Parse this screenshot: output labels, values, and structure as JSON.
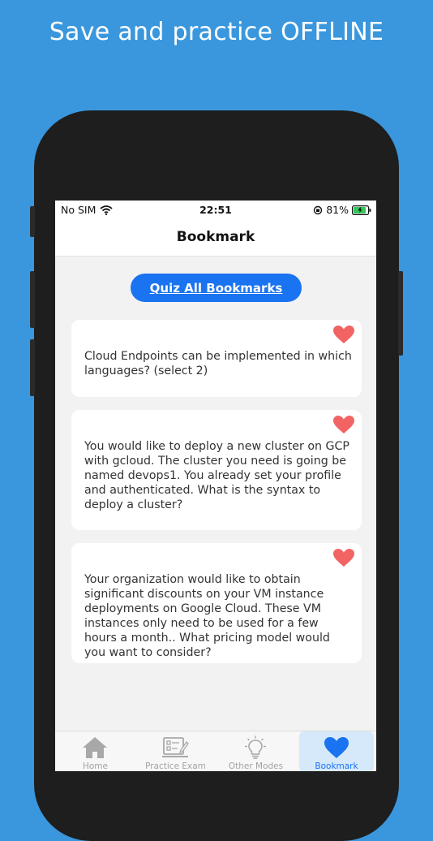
{
  "promo": {
    "headline": "Save and practice OFFLINE"
  },
  "statusbar": {
    "carrier": "No SIM",
    "time": "22:51",
    "battery": "81%"
  },
  "navbar": {
    "title": "Bookmark"
  },
  "quiz_button": {
    "label": "Quiz All Bookmarks"
  },
  "cards": [
    {
      "question": "Cloud Endpoints can be implemented in which languages? (select 2)"
    },
    {
      "question": "You would like to deploy a new cluster on GCP with gcloud. The cluster you need is going be named devops1. You already set your profile and authenticated. What is the syntax to deploy a cluster?"
    },
    {
      "question": "Your organization would like to obtain significant discounts on your VM instance deployments on Google Cloud. These VM instances only need to be used for a few hours a month.. What pricing model would you want to consider?"
    }
  ],
  "tabs": [
    {
      "label": "Home",
      "icon": "home-icon"
    },
    {
      "label": "Practice Exam",
      "icon": "exam-icon"
    },
    {
      "label": "Other Modes",
      "icon": "lightbulb-icon"
    },
    {
      "label": "Bookmark",
      "icon": "heart-icon",
      "active": true
    }
  ],
  "colors": {
    "background": "#3a97dd",
    "accent": "#1a73f0",
    "heart": "#f26464",
    "tab_inactive": "#a3a3a3"
  }
}
